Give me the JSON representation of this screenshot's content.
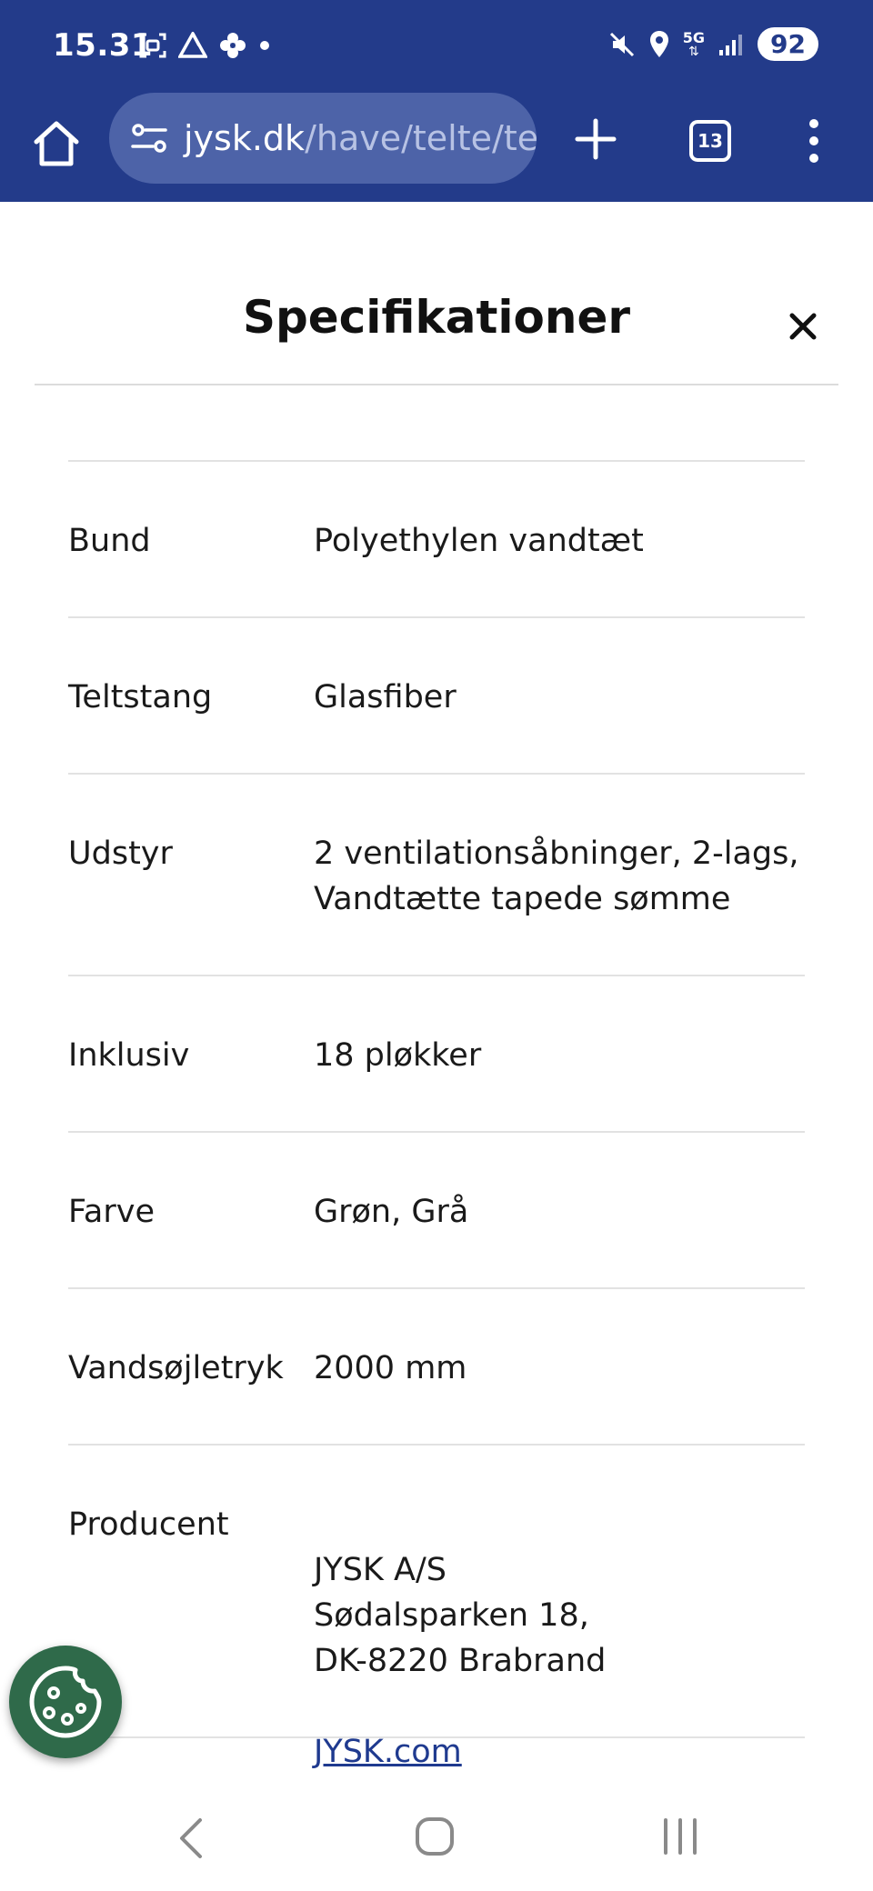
{
  "status_bar": {
    "time": "15.31",
    "network": "5G",
    "battery": "92",
    "icons": [
      "screenshot-icon",
      "drive-icon",
      "pinwheel-icon",
      "dot-icon",
      "mute-icon",
      "location-icon",
      "signal-icon"
    ]
  },
  "browser": {
    "url_domain": "jysk.dk",
    "url_path": "/have/telte/tel",
    "tab_count": "13"
  },
  "panel": {
    "title": "Specifikationer",
    "rows": [
      {
        "label": "Bund",
        "value": "Polyethylen vandtæt"
      },
      {
        "label": "Teltstang",
        "value": "Glasfiber"
      },
      {
        "label": "Udstyr",
        "value": "2 ventilationsåbninger, 2-lags,\nVandtætte tapede sømme"
      },
      {
        "label": "Inklusiv",
        "value": "18 pløkker"
      },
      {
        "label": "Farve",
        "value": "Grøn, Grå"
      },
      {
        "label": "Vandsøjletryk",
        "value": "2000 mm"
      },
      {
        "label": "Producent",
        "value": "JYSK A/S\nSødalsparken 18,\nDK-8220 Brabrand",
        "link": "JYSK.com"
      }
    ]
  },
  "colors": {
    "brand_blue": "#233b8a",
    "url_pill": "#4d63a8",
    "link": "#1f3a8f",
    "cookie_green": "#2f6a4a"
  }
}
